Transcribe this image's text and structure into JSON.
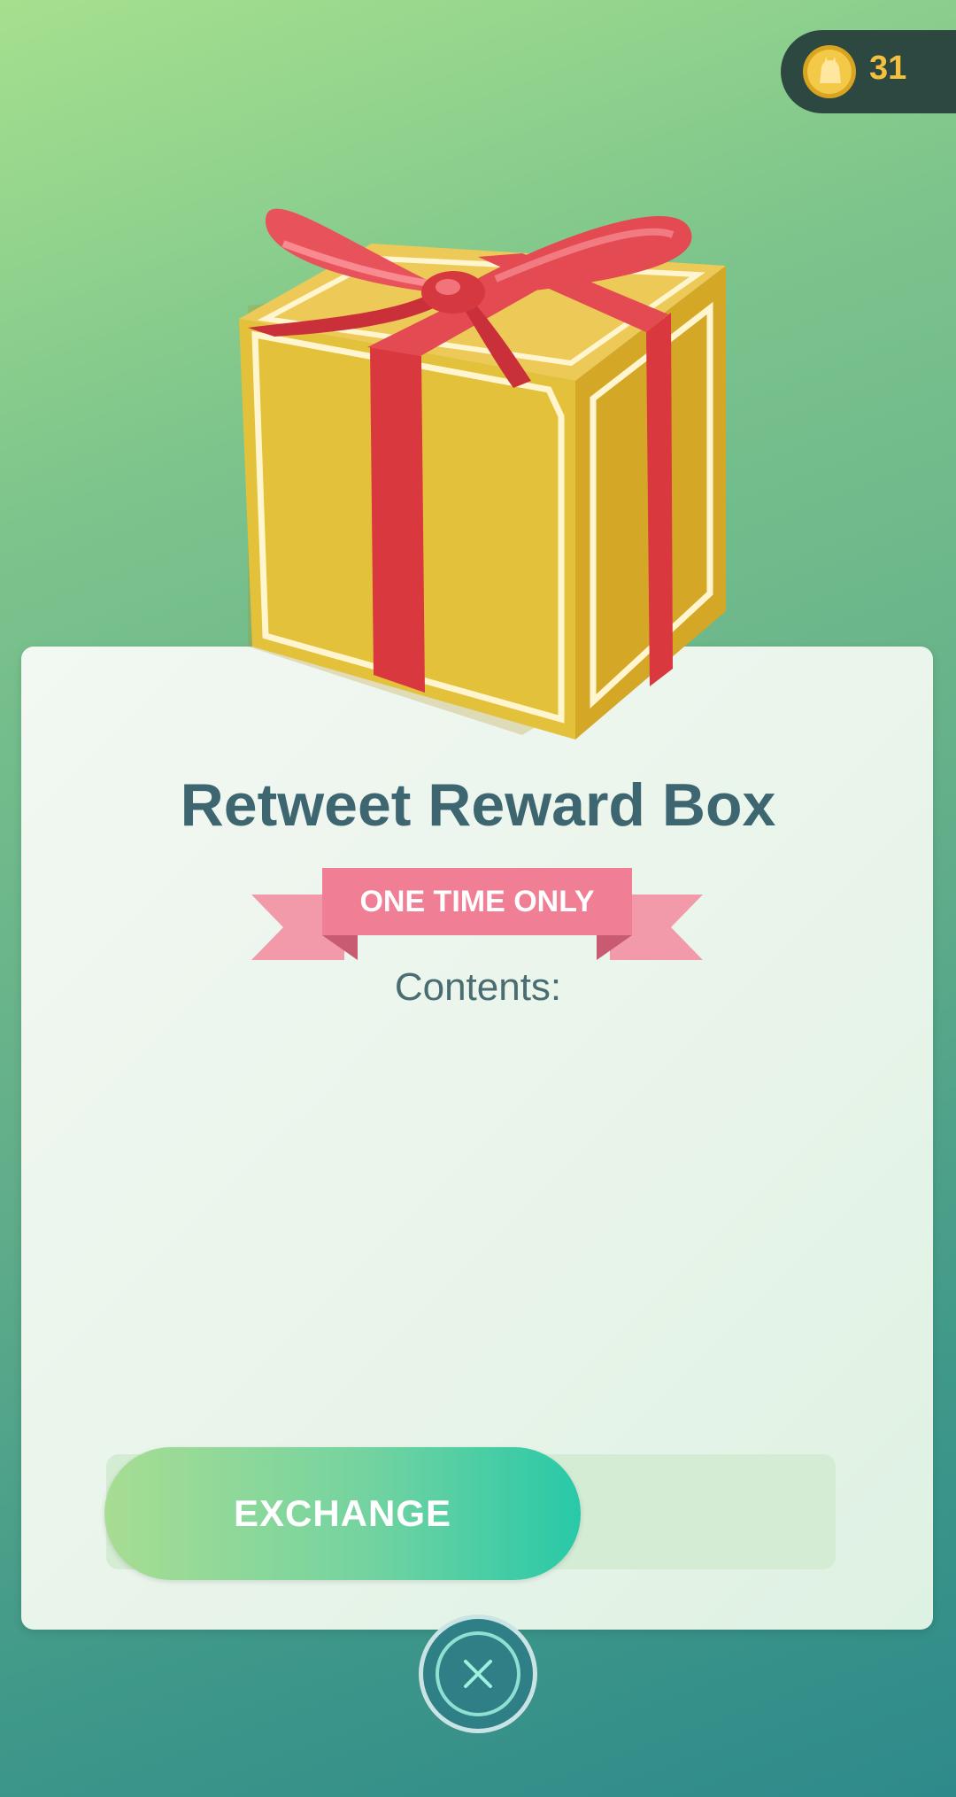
{
  "header": {
    "coin_count": "31",
    "coin_icon": "pokecoin-icon"
  },
  "reward": {
    "title": "Retweet Reward Box",
    "badge": "ONE TIME ONLY",
    "contents_label": "Contents:",
    "image_icon": "gift-box-icon"
  },
  "actions": {
    "exchange_label": "EXCHANGE",
    "close_icon": "close-icon"
  },
  "colors": {
    "title": "#3e6670",
    "ribbon": "#f07e94",
    "coin_text": "#f4c13e",
    "exchange_start": "#a8dd92",
    "exchange_end": "#28c9a8"
  }
}
